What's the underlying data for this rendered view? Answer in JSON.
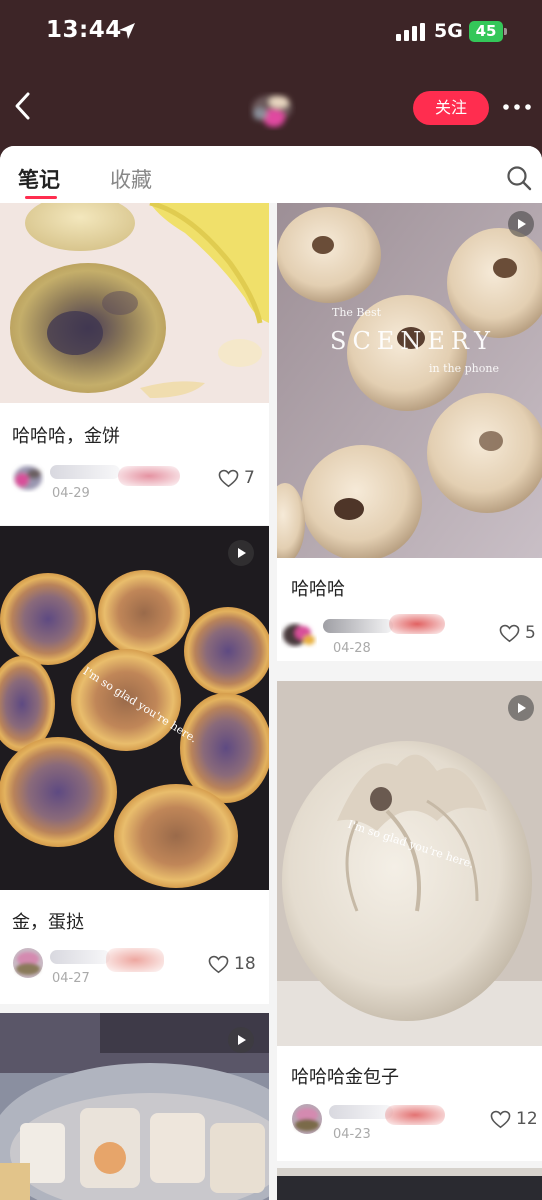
{
  "status_bar": {
    "time": "13:44",
    "network": "5G",
    "battery": "45"
  },
  "nav": {
    "follow_label": "关注"
  },
  "tabs": {
    "notes": "笔记",
    "collections": "收藏"
  },
  "colors": {
    "accent": "#ff2d4f",
    "header_bg": "#3d2527",
    "battery": "#34c759"
  },
  "icons": [
    "back-arrow-icon",
    "location-arrow-icon",
    "signal-icon",
    "more-icon",
    "search-icon",
    "play-icon",
    "heart-icon"
  ],
  "posts": [
    {
      "title": "哈哈哈，金饼",
      "date": "04-29",
      "likes": "7"
    },
    {
      "title": "哈哈哈",
      "date": "04-28",
      "likes": "5",
      "overlay": {
        "line1": "The Best",
        "line2": "SCENERY",
        "line3": "in the phone"
      }
    },
    {
      "title": "金，蛋挞",
      "date": "04-27",
      "likes": "18",
      "overlay_caption": "I'm so glad you're here."
    },
    {
      "title": "哈哈哈金包子",
      "date": "04-23",
      "likes": "12",
      "overlay_caption": "I'm so glad you're here."
    }
  ]
}
